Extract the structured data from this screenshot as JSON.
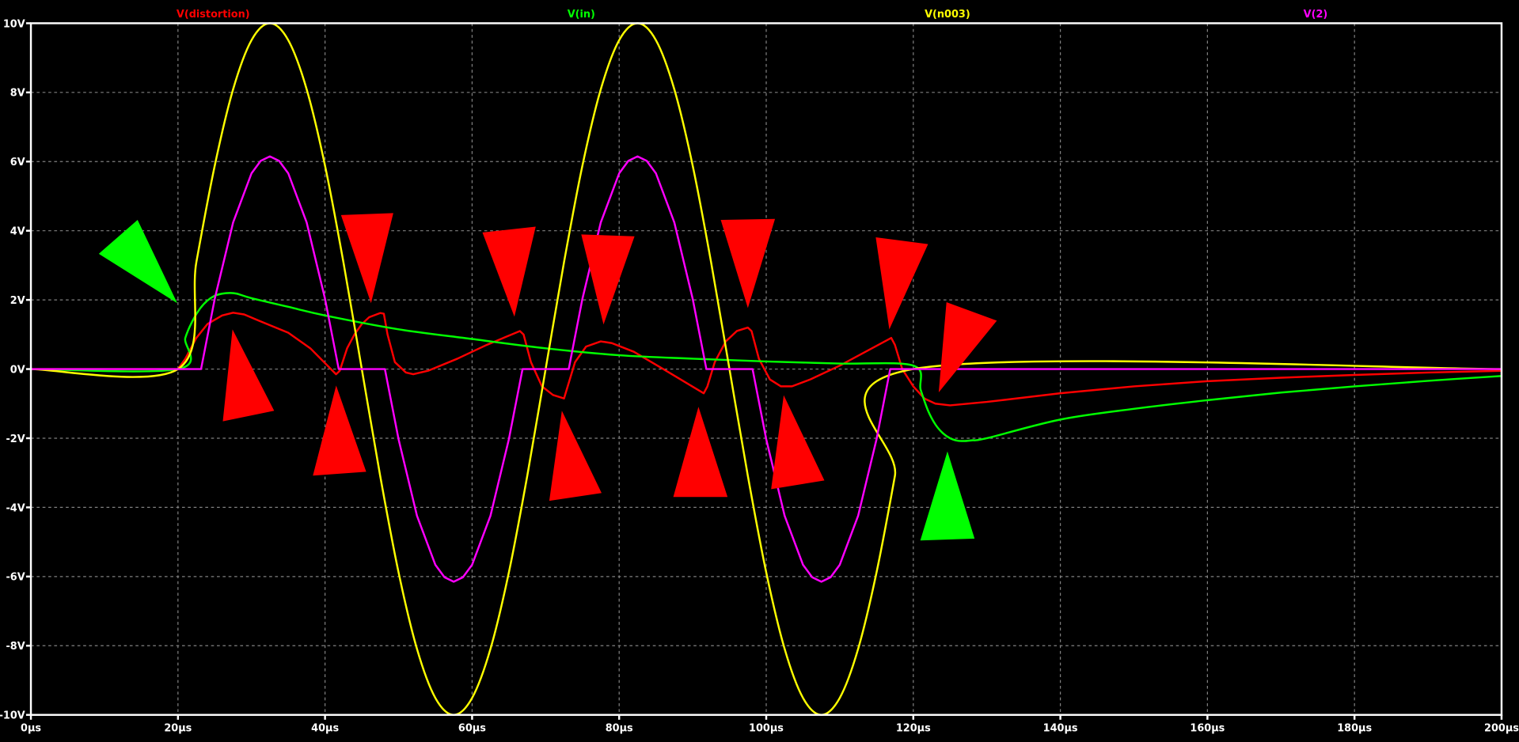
{
  "chart_data": {
    "type": "line",
    "title": "",
    "xlabel": "",
    "ylabel": "",
    "xlim": [
      0,
      200
    ],
    "ylim": [
      -10,
      10
    ],
    "x_unit": "µs",
    "y_unit": "V",
    "grid": true,
    "x_ticks": [
      "0µs",
      "20µs",
      "40µs",
      "60µs",
      "80µs",
      "100µs",
      "120µs",
      "140µs",
      "160µs",
      "180µs",
      "200µs"
    ],
    "x_tick_values": [
      0,
      20,
      40,
      60,
      80,
      100,
      120,
      140,
      160,
      180,
      200
    ],
    "y_ticks": [
      "10V",
      "8V",
      "6V",
      "4V",
      "2V",
      "0V",
      "-2V",
      "-4V",
      "-6V",
      "-8V",
      "-10V"
    ],
    "y_tick_values": [
      10,
      8,
      6,
      4,
      2,
      0,
      -2,
      -4,
      -6,
      -8,
      -10
    ],
    "background": "#000000",
    "series": [
      {
        "name": "V(distortion)",
        "color": "#ff0000",
        "smooth": false,
        "points": [
          [
            0,
            0
          ],
          [
            20,
            0
          ],
          [
            21,
            0.3
          ],
          [
            22.5,
            0.9
          ],
          [
            24,
            1.3
          ],
          [
            26,
            1.55
          ],
          [
            27.5,
            1.63
          ],
          [
            29,
            1.58
          ],
          [
            31,
            1.4
          ],
          [
            35,
            1.05
          ],
          [
            38,
            0.6
          ],
          [
            41.5,
            -0.15
          ],
          [
            42,
            -0.05
          ],
          [
            43,
            0.6
          ],
          [
            44,
            1.0
          ],
          [
            45,
            1.3
          ],
          [
            46,
            1.5
          ],
          [
            47.5,
            1.62
          ],
          [
            48,
            1.6
          ],
          [
            48.5,
            1.0
          ],
          [
            49.5,
            0.2
          ],
          [
            51,
            -0.1
          ],
          [
            52,
            -0.15
          ],
          [
            54,
            -0.05
          ],
          [
            58,
            0.3
          ],
          [
            62,
            0.7
          ],
          [
            66.5,
            1.1
          ],
          [
            67,
            1.0
          ],
          [
            68,
            0.2
          ],
          [
            69.5,
            -0.5
          ],
          [
            71,
            -0.75
          ],
          [
            72.5,
            -0.85
          ],
          [
            73,
            -0.5
          ],
          [
            74,
            0.2
          ],
          [
            75.5,
            0.65
          ],
          [
            77.5,
            0.8
          ],
          [
            79,
            0.75
          ],
          [
            82,
            0.5
          ],
          [
            86,
            0.0
          ],
          [
            91.5,
            -0.7
          ],
          [
            92,
            -0.5
          ],
          [
            93,
            0.2
          ],
          [
            94.5,
            0.8
          ],
          [
            96,
            1.1
          ],
          [
            97.5,
            1.2
          ],
          [
            98,
            1.1
          ],
          [
            99,
            0.3
          ],
          [
            100.5,
            -0.3
          ],
          [
            102,
            -0.5
          ],
          [
            103.5,
            -0.5
          ],
          [
            106,
            -0.3
          ],
          [
            110,
            0.1
          ],
          [
            117,
            0.9
          ],
          [
            117.5,
            0.7
          ],
          [
            118.5,
            0
          ],
          [
            120,
            -0.5
          ],
          [
            121.5,
            -0.85
          ],
          [
            123,
            -1.0
          ],
          [
            125,
            -1.05
          ],
          [
            130,
            -0.95
          ],
          [
            140,
            -0.7
          ],
          [
            150,
            -0.5
          ],
          [
            160,
            -0.35
          ],
          [
            170,
            -0.25
          ],
          [
            180,
            -0.17
          ],
          [
            190,
            -0.1
          ],
          [
            200,
            -0.05
          ]
        ]
      },
      {
        "name": "V(in)",
        "color": "#00ff00",
        "smooth": true,
        "points": [
          [
            0,
            0
          ],
          [
            20,
            0
          ],
          [
            21,
            0.9
          ],
          [
            22,
            1.4
          ],
          [
            23,
            1.75
          ],
          [
            24,
            1.98
          ],
          [
            25,
            2.12
          ],
          [
            26,
            2.18
          ],
          [
            27,
            2.2
          ],
          [
            28,
            2.18
          ],
          [
            30,
            2.05
          ],
          [
            35,
            1.8
          ],
          [
            40,
            1.55
          ],
          [
            50,
            1.15
          ],
          [
            60,
            0.87
          ],
          [
            70,
            0.6
          ],
          [
            80,
            0.4
          ],
          [
            90,
            0.3
          ],
          [
            100,
            0.22
          ],
          [
            110,
            0.16
          ],
          [
            120,
            0.1
          ],
          [
            121,
            -0.6
          ],
          [
            122,
            -1.2
          ],
          [
            123,
            -1.6
          ],
          [
            124,
            -1.85
          ],
          [
            125,
            -2.0
          ],
          [
            126,
            -2.07
          ],
          [
            127,
            -2.08
          ],
          [
            128,
            -2.06
          ],
          [
            130,
            -2.0
          ],
          [
            140,
            -1.46
          ],
          [
            150,
            -1.15
          ],
          [
            160,
            -0.9
          ],
          [
            170,
            -0.68
          ],
          [
            180,
            -0.5
          ],
          [
            190,
            -0.34
          ],
          [
            200,
            -0.2
          ]
        ]
      },
      {
        "name": "V(n003)",
        "color": "#ffff00",
        "smooth": true,
        "points": [
          [
            0,
            0
          ],
          [
            20,
            0
          ],
          [
            22.5,
            3.09
          ],
          [
            25,
            5.88
          ],
          [
            27.5,
            8.09
          ],
          [
            30,
            9.51
          ],
          [
            32.5,
            10
          ],
          [
            35,
            9.51
          ],
          [
            37.5,
            8.09
          ],
          [
            40,
            5.88
          ],
          [
            42.5,
            3.09
          ],
          [
            45,
            0
          ],
          [
            47.5,
            -3.09
          ],
          [
            50,
            -5.88
          ],
          [
            52.5,
            -8.09
          ],
          [
            55,
            -9.51
          ],
          [
            57.5,
            -10
          ],
          [
            60,
            -9.51
          ],
          [
            62.5,
            -8.09
          ],
          [
            65,
            -5.88
          ],
          [
            67.5,
            -3.09
          ],
          [
            70,
            0
          ],
          [
            72.5,
            3.09
          ],
          [
            75,
            5.88
          ],
          [
            77.5,
            8.09
          ],
          [
            80,
            9.51
          ],
          [
            82.5,
            10
          ],
          [
            85,
            9.51
          ],
          [
            87.5,
            8.09
          ],
          [
            90,
            5.88
          ],
          [
            92.5,
            3.09
          ],
          [
            95,
            0
          ],
          [
            97.5,
            -3.09
          ],
          [
            100,
            -5.88
          ],
          [
            102.5,
            -8.09
          ],
          [
            105,
            -9.51
          ],
          [
            107.5,
            -10
          ],
          [
            110,
            -9.51
          ],
          [
            112.5,
            -8.09
          ],
          [
            115,
            -5.88
          ],
          [
            117.5,
            -3.09
          ],
          [
            120,
            0
          ],
          [
            200,
            0
          ]
        ]
      },
      {
        "name": "V(2)",
        "color": "#ff00ff",
        "smooth": false,
        "points": [
          [
            0,
            0
          ],
          [
            23.14,
            0
          ],
          [
            25,
            2.03
          ],
          [
            27.5,
            4.24
          ],
          [
            30,
            5.66
          ],
          [
            31.25,
            6.02
          ],
          [
            32.5,
            6.15
          ],
          [
            33.75,
            6.02
          ],
          [
            35,
            5.66
          ],
          [
            37.5,
            4.24
          ],
          [
            40,
            2.03
          ],
          [
            41.86,
            0
          ],
          [
            48.14,
            0
          ],
          [
            50,
            -2.03
          ],
          [
            52.5,
            -4.24
          ],
          [
            55,
            -5.66
          ],
          [
            56.25,
            -6.02
          ],
          [
            57.5,
            -6.15
          ],
          [
            58.75,
            -6.02
          ],
          [
            60,
            -5.66
          ],
          [
            62.5,
            -4.24
          ],
          [
            65,
            -2.03
          ],
          [
            66.86,
            0
          ],
          [
            73.14,
            0
          ],
          [
            75,
            2.03
          ],
          [
            77.5,
            4.24
          ],
          [
            80,
            5.66
          ],
          [
            81.25,
            6.02
          ],
          [
            82.5,
            6.15
          ],
          [
            83.75,
            6.02
          ],
          [
            85,
            5.66
          ],
          [
            87.5,
            4.24
          ],
          [
            90,
            2.03
          ],
          [
            91.86,
            0
          ],
          [
            98.14,
            0
          ],
          [
            100,
            -2.03
          ],
          [
            102.5,
            -4.24
          ],
          [
            105,
            -5.66
          ],
          [
            106.25,
            -6.02
          ],
          [
            107.5,
            -6.15
          ],
          [
            108.75,
            -6.02
          ],
          [
            110,
            -5.66
          ],
          [
            112.5,
            -4.24
          ],
          [
            115,
            -2.03
          ],
          [
            116.86,
            0
          ],
          [
            200,
            0
          ]
        ]
      }
    ],
    "legend_placement": "top"
  }
}
